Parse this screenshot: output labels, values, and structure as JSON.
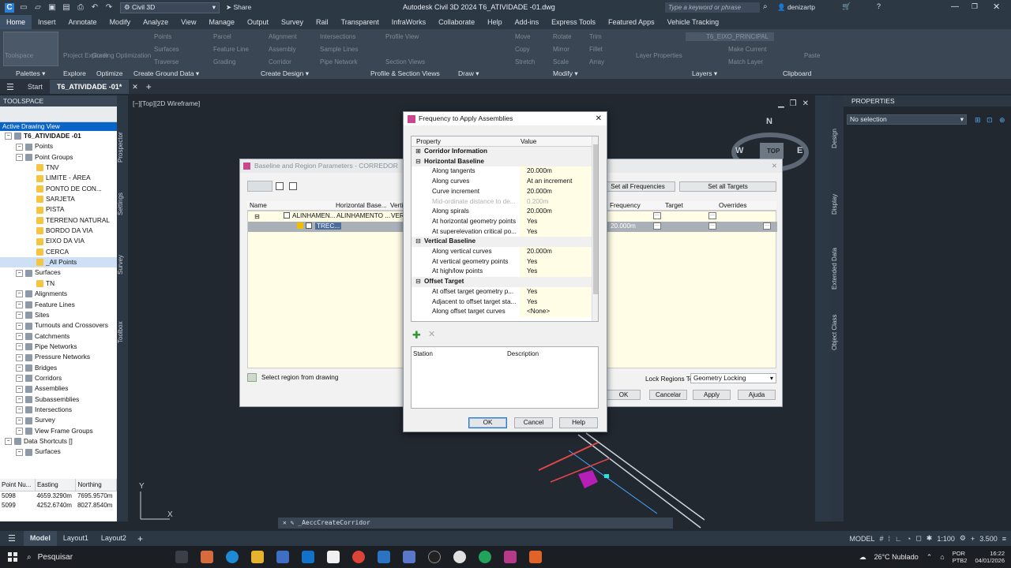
{
  "titlebar": {
    "workspace": "Civil 3D",
    "share_label": "Share",
    "app_title": "Autodesk Civil 3D 2024    T6_ATIVIDADE -01.dwg",
    "search_placeholder": "Type a keyword or phrase",
    "user": "denizartp"
  },
  "menu": [
    "Home",
    "Insert",
    "Annotate",
    "Modify",
    "Analyze",
    "View",
    "Manage",
    "Output",
    "Survey",
    "Rail",
    "Transparent",
    "InfraWorks",
    "Collaborate",
    "Help",
    "Add-ins",
    "Express Tools",
    "Featured Apps",
    "Vehicle Tracking"
  ],
  "ribbon": {
    "panels": [
      "Palettes",
      "Explore",
      "Optimize",
      "Create Ground Data",
      "Create Design",
      "Profile & Section Views",
      "Draw",
      "Modify",
      "Layers",
      "Clipboard"
    ],
    "tools": [
      "Toolspace",
      "Project Explorer",
      "Grading Optimization",
      "Points",
      "Surfaces",
      "Traverse",
      "Parcel",
      "Feature Line",
      "Grading",
      "Alignment",
      "Assembly",
      "Corridor",
      "Intersections",
      "Sample Lines",
      "Pipe Network",
      "Profile View",
      "Section Views",
      "Move",
      "Copy",
      "Stretch",
      "Rotate",
      "Mirror",
      "Scale",
      "Trim",
      "Fillet",
      "Array",
      "Layer Properties",
      "Make Current",
      "Match Layer",
      "Paste"
    ],
    "layer_name": "T6_EIXO_PRINCIPAL"
  },
  "doctabs": [
    "Start",
    "T6_ATIVIDADE -01*"
  ],
  "toolspace": {
    "header": "TOOLSPACE",
    "view": "Active Drawing View",
    "tree": [
      {
        "label": "T6_ATIVIDADE -01",
        "level": 0,
        "bold": true
      },
      {
        "label": "Points",
        "level": 1
      },
      {
        "label": "Point Groups",
        "level": 1
      },
      {
        "label": "TNV",
        "level": 2
      },
      {
        "label": "LIMITE - ÁREA",
        "level": 2
      },
      {
        "label": "PONTO DE CON...",
        "level": 2
      },
      {
        "label": "SARJETA",
        "level": 2
      },
      {
        "label": "PISTA",
        "level": 2
      },
      {
        "label": "TERRENO NATURAL",
        "level": 2
      },
      {
        "label": "BORDO DA VIA",
        "level": 2
      },
      {
        "label": "EIXO DA VIA",
        "level": 2
      },
      {
        "label": "CERCA",
        "level": 2
      },
      {
        "label": "_All Points",
        "level": 2,
        "selected": true
      },
      {
        "label": "Surfaces",
        "level": 1
      },
      {
        "label": "TN",
        "level": 2
      },
      {
        "label": "Alignments",
        "level": 1
      },
      {
        "label": "Feature Lines",
        "level": 1
      },
      {
        "label": "Sites",
        "level": 1
      },
      {
        "label": "Turnouts and Crossovers",
        "level": 1
      },
      {
        "label": "Catchments",
        "level": 1
      },
      {
        "label": "Pipe Networks",
        "level": 1
      },
      {
        "label": "Pressure Networks",
        "level": 1
      },
      {
        "label": "Bridges",
        "level": 1
      },
      {
        "label": "Corridors",
        "level": 1
      },
      {
        "label": "Assemblies",
        "level": 1
      },
      {
        "label": "Subassemblies",
        "level": 1
      },
      {
        "label": "Intersections",
        "level": 1
      },
      {
        "label": "Survey",
        "level": 1
      },
      {
        "label": "View Frame Groups",
        "level": 1
      },
      {
        "label": "Data Shortcuts []",
        "level": 0
      },
      {
        "label": "Surfaces",
        "level": 1
      }
    ],
    "side_tabs": [
      "Prospector",
      "Settings",
      "Survey",
      "Toolbox"
    ]
  },
  "points_table": {
    "columns": [
      "Point Nu...",
      "Easting",
      "Northing"
    ],
    "rows": [
      [
        "5098",
        "4659.3290m",
        "7695.9570m"
      ],
      [
        "5099",
        "4252.6740m",
        "8027.8540m"
      ]
    ]
  },
  "viewport": {
    "label": "[−][Top][2D Wireframe]",
    "viewcube_top": "TOP",
    "compass": {
      "n": "N",
      "w": "W",
      "e": "E"
    },
    "command_line": "_AeccCreateCorridor",
    "ucs_y": "Y",
    "ucs_x": "X"
  },
  "baseline_dialog": {
    "title": "Baseline and Region Parameters - CORREDOR",
    "buttons_top": [
      "Set all Frequencies",
      "Set all Targets"
    ],
    "columns": [
      "Name",
      "Horizontal Base...",
      "Verti...",
      "Frequency",
      "Target",
      "Overrides"
    ],
    "row1": {
      "name": "ALINHAMEN...",
      "horizontal": "ALINHAMENTO ...",
      "vertical": "VERT"
    },
    "row2": {
      "name": "TREC...",
      "frequency": "20.000m"
    },
    "select_region": "Select region from drawing",
    "lock_label": "Lock Regions To:",
    "lock_value": "Geometry Locking",
    "bottom_buttons": [
      "OK",
      "Cancelar",
      "Apply",
      "Ajuda"
    ]
  },
  "frequency_dialog": {
    "title": "Frequency to Apply Assemblies",
    "col_property": "Property",
    "col_value": "Value",
    "rows": [
      {
        "type": "cat",
        "label": "Corridor Information",
        "collapsed": true
      },
      {
        "type": "cat",
        "label": "Horizontal Baseline"
      },
      {
        "type": "prop",
        "label": "Along tangents",
        "value": "20.000m"
      },
      {
        "type": "prop",
        "label": "Along curves",
        "value": "At an increment"
      },
      {
        "type": "prop",
        "label": "Curve increment",
        "value": "20.000m"
      },
      {
        "type": "prop",
        "label": "Mid-ordinate distance to de...",
        "value": "0.200m",
        "disabled": true
      },
      {
        "type": "prop",
        "label": "Along spirals",
        "value": "20.000m"
      },
      {
        "type": "prop",
        "label": "At horizontal geometry points",
        "value": "Yes"
      },
      {
        "type": "prop",
        "label": "At superelevation critical po...",
        "value": "Yes"
      },
      {
        "type": "cat",
        "label": "Vertical Baseline"
      },
      {
        "type": "prop",
        "label": "Along vertical curves",
        "value": "20.000m"
      },
      {
        "type": "prop",
        "label": "At vertical geometry points",
        "value": "Yes"
      },
      {
        "type": "prop",
        "label": "At high/low points",
        "value": "Yes"
      },
      {
        "type": "cat",
        "label": "Offset Target"
      },
      {
        "type": "prop",
        "label": "At offset target geometry p...",
        "value": "Yes"
      },
      {
        "type": "prop",
        "label": "Adjacent to offset target sta...",
        "value": "Yes"
      },
      {
        "type": "prop",
        "label": "Along offset target curves",
        "value": "<None>"
      }
    ],
    "station_cols": [
      "Station",
      "Description"
    ],
    "buttons": [
      "OK",
      "Cancel",
      "Help"
    ]
  },
  "properties": {
    "header": "PROPERTIES",
    "selection": "No selection",
    "side_tabs": [
      "Design",
      "Display",
      "Extended Data",
      "Object Class"
    ]
  },
  "bottombar": {
    "tabs": [
      "Model",
      "Layout1",
      "Layout2"
    ],
    "model_label": "MODEL",
    "scale": "1:100",
    "value": "3.500"
  },
  "taskbar": {
    "search": "Pesquisar",
    "weather": "26°C  Nublado",
    "lang": "POR",
    "lang2": "PTB2",
    "time": "16:22",
    "date": "04/01/2026"
  },
  "colors": {
    "accent": "#0a64c8",
    "dialog_yellow": "#fffde6",
    "dark_bg": "#212830"
  }
}
